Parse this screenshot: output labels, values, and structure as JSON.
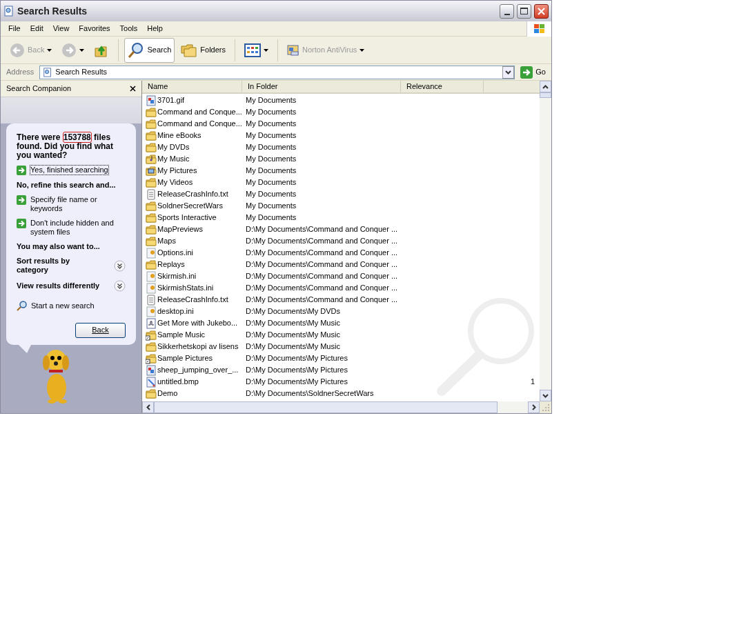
{
  "window": {
    "title": "Search Results"
  },
  "menu": [
    "File",
    "Edit",
    "View",
    "Favorites",
    "Tools",
    "Help"
  ],
  "toolbar": [
    {
      "kind": "back",
      "label": "Back",
      "disabled": true
    },
    {
      "kind": "forward",
      "disabled": true
    },
    {
      "kind": "up"
    },
    {
      "kind": "search",
      "label": "Search",
      "selected": true
    },
    {
      "kind": "folders",
      "label": "Folders",
      "selected": false
    },
    {
      "kind": "views"
    },
    {
      "kind": "norton",
      "label": "Norton AntiVirus",
      "disabled": true
    }
  ],
  "address": {
    "label": "Address",
    "value": "Search Results",
    "go": "Go"
  },
  "companion": {
    "title": "Search Companion",
    "message_before": "There were",
    "count": "153788",
    "message_after": "files found. Did you find what you wanted?",
    "links": [
      {
        "kind": "arrow",
        "label": "Yes, finished searching",
        "focused": true
      },
      {
        "kind": "heading",
        "label": "No, refine this search and..."
      },
      {
        "kind": "arrow",
        "label": "Specify file name or keywords",
        "focused": false
      },
      {
        "kind": "arrow",
        "label": "Don't include hidden and system files",
        "focused": false
      },
      {
        "kind": "heading",
        "label": "You may also want to..."
      },
      {
        "kind": "expander",
        "label": "Sort results by category"
      },
      {
        "kind": "expander",
        "label": "View results differently"
      },
      {
        "kind": "search",
        "label": "Start a new search"
      }
    ],
    "back": "Back"
  },
  "table": {
    "columns": [
      "Name",
      "In Folder",
      "Relevance"
    ],
    "rows": [
      {
        "kind": "image",
        "name": "3701.gif",
        "folder": "My Documents"
      },
      {
        "kind": "folder",
        "name": "Command and Conque...",
        "folder": "My Documents"
      },
      {
        "kind": "folder",
        "name": "Command and Conque...",
        "folder": "My Documents"
      },
      {
        "kind": "folder",
        "name": "Mine eBooks",
        "folder": "My Documents"
      },
      {
        "kind": "folder",
        "name": "My DVDs",
        "folder": "My Documents"
      },
      {
        "kind": "music",
        "name": "My Music",
        "folder": "My Documents"
      },
      {
        "kind": "pictures",
        "name": "My Pictures",
        "folder": "My Documents"
      },
      {
        "kind": "folder",
        "name": "My Videos",
        "folder": "My Documents"
      },
      {
        "kind": "text",
        "name": "ReleaseCrashInfo.txt",
        "folder": "My Documents"
      },
      {
        "kind": "folder",
        "name": "SoldnerSecretWars",
        "folder": "My Documents"
      },
      {
        "kind": "folder",
        "name": "Sports Interactive",
        "folder": "My Documents"
      },
      {
        "kind": "folder",
        "name": "MapPreviews",
        "folder": "D:\\My Documents\\Command and Conquer ..."
      },
      {
        "kind": "folder",
        "name": "Maps",
        "folder": "D:\\My Documents\\Command and Conquer ..."
      },
      {
        "kind": "ini",
        "name": "Options.ini",
        "folder": "D:\\My Documents\\Command and Conquer ..."
      },
      {
        "kind": "folder",
        "name": "Replays",
        "folder": "D:\\My Documents\\Command and Conquer ..."
      },
      {
        "kind": "ini",
        "name": "Skirmish.ini",
        "folder": "D:\\My Documents\\Command and Conquer ..."
      },
      {
        "kind": "ini",
        "name": "SkirmishStats.ini",
        "folder": "D:\\My Documents\\Command and Conquer ..."
      },
      {
        "kind": "text",
        "name": "ReleaseCrashInfo.txt",
        "folder": "D:\\My Documents\\Command and Conquer ..."
      },
      {
        "kind": "ini",
        "name": "desktop.ini",
        "folder": "D:\\My Documents\\My DVDs"
      },
      {
        "kind": "audio",
        "name": "Get More with Jukebo...",
        "folder": "D:\\My Documents\\My Music"
      },
      {
        "kind": "shortcut",
        "name": "Sample Music",
        "folder": "D:\\My Documents\\My Music"
      },
      {
        "kind": "folder",
        "name": "Sikkerhetskopi av lisens",
        "folder": "D:\\My Documents\\My Music"
      },
      {
        "kind": "shortcut",
        "name": "Sample Pictures",
        "folder": "D:\\My Documents\\My Pictures"
      },
      {
        "kind": "image",
        "name": "sheep_jumping_over_...",
        "folder": "D:\\My Documents\\My Pictures"
      },
      {
        "kind": "bitmap",
        "name": "untitled.bmp",
        "folder": "D:\\My Documents\\My Pictures",
        "column_4": "1"
      },
      {
        "kind": "folder",
        "name": "Demo",
        "folder": "D:\\My Documents\\SoldnerSecretWars"
      }
    ]
  }
}
